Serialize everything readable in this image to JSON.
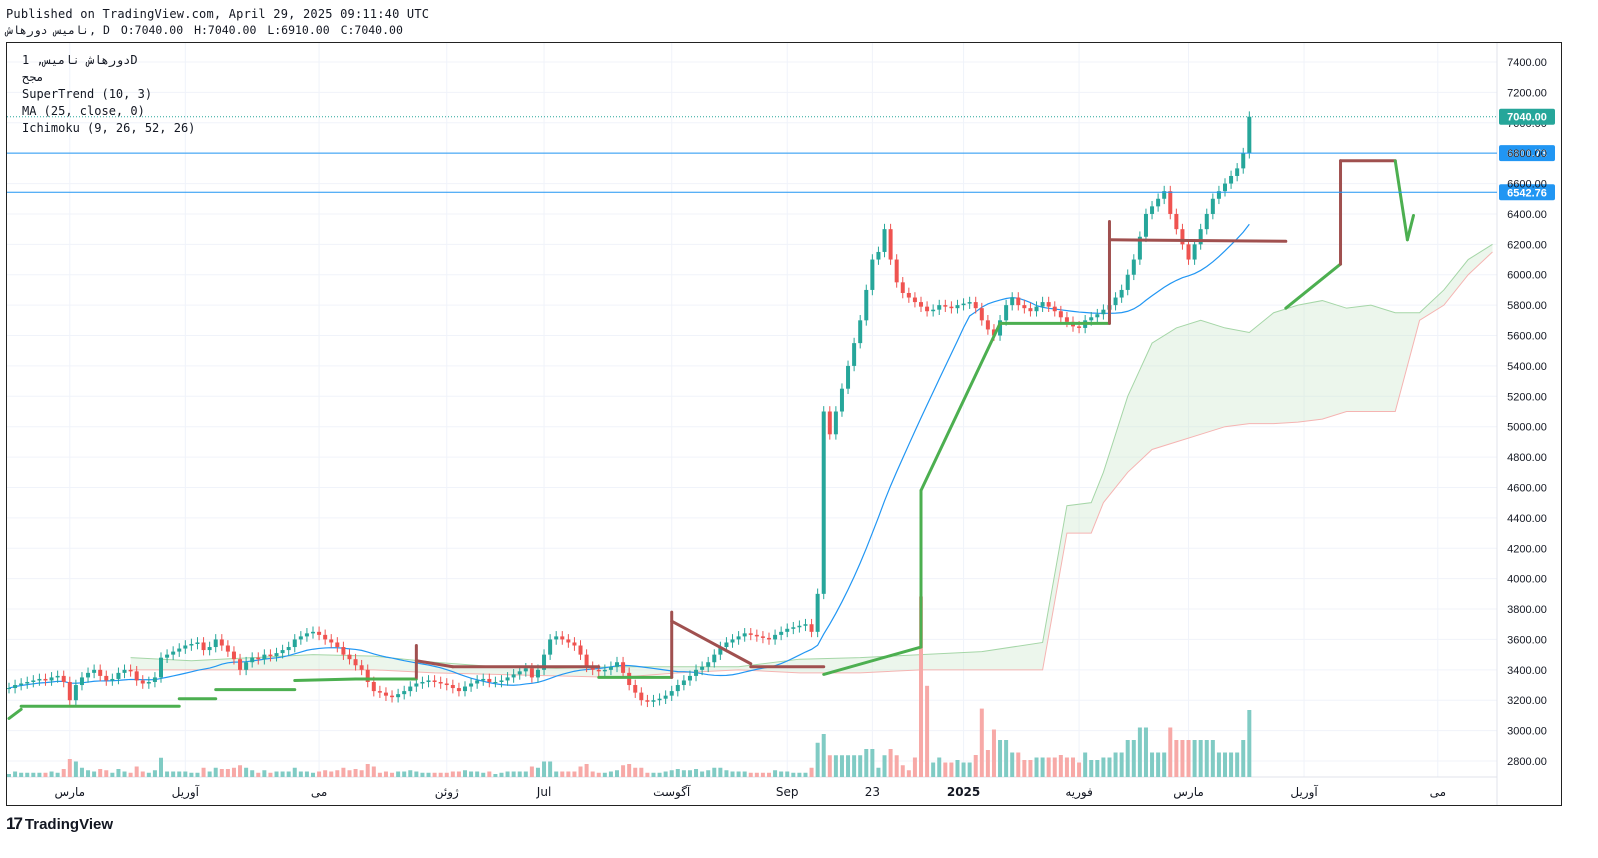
{
  "header": {
    "published": "Published on TradingView.com, April 29, 2025 09:11:40 UTC",
    "symbol": "ناميس دورهاش, D",
    "ohlc": {
      "o": "O:7040.00",
      "h": "H:7040.00",
      "l": "L:6910.00",
      "c": "C:7040.00"
    }
  },
  "legend": {
    "line1": "دورهاش ناميس, 1D",
    "line2": "مجح",
    "supertrend": "SuperTrend (10, 3)",
    "ma": "MA (25, close, 0)",
    "ichimoku": "Ichimoku (9, 26, 52, 26)"
  },
  "logo": {
    "text": "TradingView",
    "mark": "17"
  },
  "colors": {
    "up": "#26a69a",
    "down": "#ef5350",
    "vol_up": "#80cbc4",
    "vol_down": "#f7a9a7",
    "st_up": "#4caf50",
    "st_down": "#a0504f",
    "ma": "#2196f3",
    "h_line": "#2196f3",
    "cloud_up": "#a5d6a7",
    "cloud_down": "#f5b4b2",
    "last": "#26a69a"
  },
  "chart_data": {
    "type": "candlestick",
    "y_range": [
      2700,
      7500
    ],
    "y_ticks": [
      "7400.00",
      "7200.00",
      "7000.00",
      "6800.00",
      "6600.00",
      "6400.00",
      "6200.00",
      "6000.00",
      "5800.00",
      "5600.00",
      "5400.00",
      "5200.00",
      "5000.00",
      "4800.00",
      "4600.00",
      "4400.00",
      "4200.00",
      "4000.00",
      "3800.00",
      "3600.00",
      "3400.00",
      "3200.00",
      "3000.00",
      "2800.00"
    ],
    "x_labels": [
      {
        "text": "مارس",
        "bar": 10
      },
      {
        "text": "آوریل",
        "bar": 29
      },
      {
        "text": "می",
        "bar": 51
      },
      {
        "text": "ژوئن",
        "bar": 72
      },
      {
        "text": "Jul",
        "bar": 88
      },
      {
        "text": "آگوست",
        "bar": 109
      },
      {
        "text": "Sep",
        "bar": 128
      },
      {
        "text": "23",
        "bar": 142
      },
      {
        "text": "2025",
        "bar": 157
      },
      {
        "text": "فوریه",
        "bar": 176
      },
      {
        "text": "مارس",
        "bar": 194
      },
      {
        "text": "آوریل",
        "bar": 213
      },
      {
        "text": "می",
        "bar": 235
      }
    ],
    "horizontal_lines": [
      {
        "value": 6800.73,
        "label": "6800.73"
      },
      {
        "value": 6542.76,
        "label": "6542.76"
      }
    ],
    "last_price": {
      "value": 7040.0,
      "label": "7040.00"
    },
    "closes": [
      3280,
      3300,
      3310,
      3320,
      3330,
      3340,
      3330,
      3350,
      3360,
      3320,
      3200,
      3300,
      3350,
      3380,
      3400,
      3360,
      3330,
      3340,
      3380,
      3400,
      3390,
      3330,
      3310,
      3320,
      3350,
      3480,
      3500,
      3520,
      3540,
      3560,
      3570,
      3580,
      3530,
      3550,
      3600,
      3560,
      3520,
      3470,
      3400,
      3450,
      3480,
      3470,
      3500,
      3490,
      3510,
      3530,
      3550,
      3600,
      3620,
      3640,
      3650,
      3630,
      3600,
      3580,
      3550,
      3500,
      3470,
      3430,
      3400,
      3320,
      3260,
      3250,
      3230,
      3220,
      3240,
      3260,
      3290,
      3310,
      3320,
      3330,
      3320,
      3310,
      3300,
      3280,
      3260,
      3290,
      3310,
      3330,
      3340,
      3320,
      3320,
      3330,
      3350,
      3370,
      3390,
      3410,
      3350,
      3400,
      3500,
      3600,
      3620,
      3600,
      3580,
      3560,
      3500,
      3420,
      3400,
      3390,
      3400,
      3420,
      3450,
      3380,
      3300,
      3250,
      3200,
      3190,
      3200,
      3210,
      3230,
      3260,
      3300,
      3330,
      3360,
      3400,
      3420,
      3450,
      3500,
      3550,
      3580,
      3600,
      3620,
      3640,
      3630,
      3620,
      3610,
      3600,
      3630,
      3650,
      3670,
      3680,
      3690,
      3700,
      3650,
      3900,
      5100,
      4950,
      5100,
      5250,
      5400,
      5550,
      5700,
      5900,
      6100,
      6150,
      6300,
      6100,
      5950,
      5880,
      5850,
      5820,
      5790,
      5760,
      5770,
      5800,
      5790,
      5780,
      5800,
      5810,
      5820,
      5780,
      5700,
      5640,
      5600,
      5700,
      5800,
      5850,
      5800,
      5780,
      5760,
      5790,
      5820,
      5790,
      5760,
      5720,
      5690,
      5660,
      5650,
      5700,
      5720,
      5740,
      5770,
      5800,
      5850,
      5900,
      6000,
      6100,
      6250,
      6400,
      6450,
      6500,
      6550,
      6400,
      6300,
      6200,
      6100,
      6200,
      6300,
      6400,
      6500,
      6550,
      6600,
      6650,
      6700,
      6800,
      7040
    ],
    "ma": {
      "name": "MA (25, close, 0)",
      "period": 25
    },
    "supertrend": [
      {
        "x0": 0,
        "x1": 2,
        "y0": 3080,
        "y1": 3140,
        "dir": "up"
      },
      {
        "x0": 2,
        "x1": 28,
        "y0": 3160,
        "y1": 3160,
        "dir": "up"
      },
      {
        "x0": 28,
        "x1": 34,
        "y0": 3210,
        "y1": 3210,
        "dir": "up"
      },
      {
        "x0": 34,
        "x1": 47,
        "y0": 3270,
        "y1": 3270,
        "dir": "up"
      },
      {
        "x0": 47,
        "x1": 57,
        "y0": 3330,
        "y1": 3340,
        "dir": "up"
      },
      {
        "x0": 57,
        "x1": 67,
        "y0": 3340,
        "y1": 3340,
        "dir": "up"
      },
      {
        "x0": 67,
        "x1": 67,
        "y0": 3350,
        "y1": 3560,
        "dir": "down"
      },
      {
        "x0": 67,
        "x1": 73,
        "y0": 3460,
        "y1": 3420,
        "dir": "down"
      },
      {
        "x0": 73,
        "x1": 97,
        "y0": 3420,
        "y1": 3420,
        "dir": "down"
      },
      {
        "x0": 97,
        "x1": 109,
        "y0": 3350,
        "y1": 3350,
        "dir": "up"
      },
      {
        "x0": 109,
        "x1": 109,
        "y0": 3350,
        "y1": 3780,
        "dir": "down"
      },
      {
        "x0": 109,
        "x1": 122,
        "y0": 3720,
        "y1": 3440,
        "dir": "down"
      },
      {
        "x0": 122,
        "x1": 134,
        "y0": 3420,
        "y1": 3420,
        "dir": "down"
      },
      {
        "x0": 134,
        "x1": 150,
        "y0": 3370,
        "y1": 3550,
        "dir": "up"
      },
      {
        "x0": 150,
        "x1": 150,
        "y0": 3550,
        "y1": 4580,
        "dir": "up"
      },
      {
        "x0": 150,
        "x1": 163,
        "y0": 4580,
        "y1": 5680,
        "dir": "up"
      },
      {
        "x0": 163,
        "x1": 181,
        "y0": 5680,
        "y1": 5680,
        "dir": "up"
      },
      {
        "x0": 181,
        "x1": 181,
        "y0": 5680,
        "y1": 6350,
        "dir": "down"
      },
      {
        "x0": 181,
        "x1": 210,
        "y0": 6230,
        "y1": 6220,
        "dir": "down"
      },
      {
        "x0": 210,
        "x1": 219,
        "y0": 5780,
        "y1": 6070,
        "dir": "up"
      },
      {
        "x0": 219,
        "x1": 219,
        "y0": 6070,
        "y1": 6750,
        "dir": "down"
      },
      {
        "x0": 219,
        "x1": 228,
        "y0": 6750,
        "y1": 6750,
        "dir": "down"
      },
      {
        "x0": 228,
        "x1": 230,
        "y0": 6750,
        "y1": 6230,
        "dir": "up"
      },
      {
        "x0": 230,
        "x1": 231,
        "y0": 6230,
        "y1": 6390,
        "dir": "up"
      }
    ],
    "cloud_top": [
      {
        "bar": 20,
        "v": 3480
      },
      {
        "bar": 30,
        "v": 3460
      },
      {
        "bar": 40,
        "v": 3480
      },
      {
        "bar": 50,
        "v": 3500
      },
      {
        "bar": 60,
        "v": 3490
      },
      {
        "bar": 70,
        "v": 3450
      },
      {
        "bar": 80,
        "v": 3420
      },
      {
        "bar": 90,
        "v": 3410
      },
      {
        "bar": 100,
        "v": 3420
      },
      {
        "bar": 110,
        "v": 3420
      },
      {
        "bar": 120,
        "v": 3420
      },
      {
        "bar": 130,
        "v": 3470
      },
      {
        "bar": 140,
        "v": 3480
      },
      {
        "bar": 150,
        "v": 3500
      },
      {
        "bar": 160,
        "v": 3520
      },
      {
        "bar": 170,
        "v": 3580
      },
      {
        "bar": 174,
        "v": 4480
      },
      {
        "bar": 178,
        "v": 4500
      },
      {
        "bar": 180,
        "v": 4700
      },
      {
        "bar": 184,
        "v": 5200
      },
      {
        "bar": 188,
        "v": 5550
      },
      {
        "bar": 192,
        "v": 5650
      },
      {
        "bar": 196,
        "v": 5700
      },
      {
        "bar": 200,
        "v": 5650
      },
      {
        "bar": 204,
        "v": 5620
      },
      {
        "bar": 208,
        "v": 5750
      },
      {
        "bar": 212,
        "v": 5800
      },
      {
        "bar": 216,
        "v": 5830
      },
      {
        "bar": 220,
        "v": 5780
      },
      {
        "bar": 224,
        "v": 5800
      },
      {
        "bar": 228,
        "v": 5750
      },
      {
        "bar": 232,
        "v": 5750
      },
      {
        "bar": 236,
        "v": 5900
      },
      {
        "bar": 240,
        "v": 6100
      },
      {
        "bar": 244,
        "v": 6200
      }
    ],
    "cloud_bottom": [
      {
        "bar": 20,
        "v": 3400
      },
      {
        "bar": 30,
        "v": 3400
      },
      {
        "bar": 40,
        "v": 3400
      },
      {
        "bar": 50,
        "v": 3400
      },
      {
        "bar": 60,
        "v": 3400
      },
      {
        "bar": 70,
        "v": 3380
      },
      {
        "bar": 80,
        "v": 3370
      },
      {
        "bar": 90,
        "v": 3360
      },
      {
        "bar": 100,
        "v": 3350
      },
      {
        "bar": 110,
        "v": 3380
      },
      {
        "bar": 120,
        "v": 3400
      },
      {
        "bar": 130,
        "v": 3380
      },
      {
        "bar": 140,
        "v": 3380
      },
      {
        "bar": 150,
        "v": 3400
      },
      {
        "bar": 160,
        "v": 3400
      },
      {
        "bar": 170,
        "v": 3400
      },
      {
        "bar": 174,
        "v": 4300
      },
      {
        "bar": 178,
        "v": 4300
      },
      {
        "bar": 180,
        "v": 4500
      },
      {
        "bar": 184,
        "v": 4700
      },
      {
        "bar": 188,
        "v": 4850
      },
      {
        "bar": 192,
        "v": 4900
      },
      {
        "bar": 196,
        "v": 4950
      },
      {
        "bar": 200,
        "v": 5000
      },
      {
        "bar": 204,
        "v": 5020
      },
      {
        "bar": 208,
        "v": 5020
      },
      {
        "bar": 212,
        "v": 5030
      },
      {
        "bar": 216,
        "v": 5050
      },
      {
        "bar": 220,
        "v": 5100
      },
      {
        "bar": 224,
        "v": 5100
      },
      {
        "bar": 228,
        "v": 5100
      },
      {
        "bar": 232,
        "v": 5700
      },
      {
        "bar": 236,
        "v": 5800
      },
      {
        "bar": 240,
        "v": 6000
      },
      {
        "bar": 244,
        "v": 6150
      }
    ],
    "volume_spikes": [
      {
        "bar": 150,
        "v": 0.95,
        "dir": "down"
      },
      {
        "bar": 151,
        "v": 0.48,
        "dir": "down"
      },
      {
        "bar": 160,
        "v": 0.36,
        "dir": "down"
      },
      {
        "bar": 162,
        "v": 0.25,
        "dir": "up"
      }
    ]
  }
}
